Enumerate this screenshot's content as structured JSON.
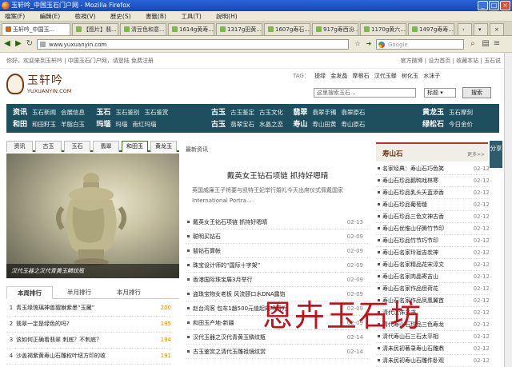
{
  "window": {
    "title": "玉轩吟_中国玉石门户网 - Mozilla Firefox"
  },
  "menu": [
    "檔案(F)",
    "編輯(E)",
    "檢視(V)",
    "歷史(S)",
    "書籤(B)",
    "工具(T)",
    "說明(H)"
  ],
  "tabs": [
    {
      "label": "玉轩吟_中国玉..."
    },
    {
      "label": "【图片】翡..."
    },
    {
      "label": "清豆色和意..."
    },
    {
      "label": "1614g黄寿..."
    },
    {
      "label": "1317g田黄..."
    },
    {
      "label": "1607g寿石..."
    },
    {
      "label": "917g寿西汾..."
    },
    {
      "label": "1170g黄六..."
    },
    {
      "label": "1497g寿寿..."
    }
  ],
  "nav": {
    "url": "www.yuxuanyin.com",
    "search_placeholder": "Google"
  },
  "topinfo": {
    "left": "你好，欢迎来到玉轩吟 | 中国玉石门户网，请登陆 免费注册",
    "right": "官方微博 | 设为首页 | 收藏本站 | 玉石说"
  },
  "logo": {
    "name": "玉轩吟",
    "domain": "YUXUANYIN.COM"
  },
  "tags": {
    "label": "TAG：",
    "items": [
      "提绿",
      "金发晶",
      "摩根石",
      "汉代玉蝉",
      "树化玉",
      "水沫子"
    ]
  },
  "sitesearch": {
    "placeholder": "这里搜索玉石...",
    "select": "标题",
    "button": "搜索"
  },
  "mainnav": [
    {
      "head": "资讯",
      "items": [
        "玉石新闻",
        "会展信息"
      ],
      "head2": "玉石",
      "items2": [
        "玉石鉴别",
        "玉石鉴赏"
      ]
    },
    {
      "head": "和田",
      "items": [
        "和田籽玉",
        "羊脂白玉"
      ],
      "head2": "玛瑙",
      "items2": [
        "玛瑙",
        "南红玛瑙"
      ]
    },
    {
      "head": "古玉",
      "items": [
        "古玉鉴定",
        "古玉文化"
      ],
      "head2": "翡翠",
      "items2": [
        "翡翠手镯",
        "翡翠原石"
      ]
    },
    {
      "head": "古玉",
      "items": [
        "翡翠宝石",
        "水晶之恋"
      ],
      "head2": "寿山",
      "items2": [
        "寿山田黄",
        "寿山原石"
      ]
    },
    {
      "head": "黄龙玉",
      "items": [
        "玉石摩刻"
      ],
      "head2": "绿松石",
      "items2": [
        "今日金价"
      ]
    }
  ],
  "cattabs": [
    "资讯",
    "古玉",
    "玉石",
    "翡翠",
    "和田玉",
    "黄龙玉"
  ],
  "photo": {
    "caption": "汉代玉器之汉代青黄玉鳞纹瓶"
  },
  "ranktabs": [
    "本周排行",
    "半月排行",
    "本月排行"
  ],
  "ranking": [
    {
      "n": "1",
      "title": "青玉缘琉璃神兽貔貅紫墨“玉藏”",
      "count": "200"
    },
    {
      "n": "2",
      "title": "翡翠一定是绿色的吗?",
      "count": "195"
    },
    {
      "n": "3",
      "title": "该如何正确看翡翠 刺底？不刺底？",
      "count": "194"
    },
    {
      "n": "4",
      "title": "沙盖褐紫黄寿山石雕权叶纽方印的收",
      "count": "191"
    }
  ],
  "middle": {
    "section": "最新资讯",
    "headline": "戴英女王钻石项链 抓持好嗯晴",
    "summary": "英国威廉王子将要与凯特王妃举行婚礼今天出席仪式佩戴国家 International Portra...",
    "news": [
      {
        "title": "戴英女王钻石项链 抓持好嗯晴",
        "date": "02-13"
      },
      {
        "title": "聪明买钻石",
        "date": "02-09"
      },
      {
        "title": "替钻石算帐",
        "date": "02-09"
      },
      {
        "title": "珠宝设计师的“国际十字架”",
        "date": "02-09"
      },
      {
        "title": "香港国际珠宝展3月举行",
        "date": "02-09"
      },
      {
        "title": "盗珠宝物女老板 风流颐口水DNA露馅",
        "date": "02-09"
      },
      {
        "title": "赵台湾客 包车1趟500元值起的吗石为",
        "date": "02-09"
      },
      {
        "title": "和田玉产地-新疆",
        "date": "02-09"
      },
      {
        "title": "汉代玉器之汉代青黄玉鳞纹瓶",
        "date": "02-14"
      },
      {
        "title": "古玉鉴赏之清代玉雕祖镜纹赏",
        "date": "02-14"
      }
    ]
  },
  "right": {
    "title": "寿山石",
    "more": "更多>>",
    "items": [
      {
        "title": "名家经典：寿山石巧色笑",
        "date": "02-12"
      },
      {
        "title": "寿山石珍品鹅鸭戏林寒",
        "date": "02-12"
      },
      {
        "title": "寿山石珍品乳头天蓝添香",
        "date": "02-12"
      },
      {
        "title": "寿山石珍品葡萄缝",
        "date": "02-12"
      },
      {
        "title": "寿山石珍品三色文神古香",
        "date": "02-12"
      },
      {
        "title": "寿山石优惟山仔腾竹节印",
        "date": "02-12"
      },
      {
        "title": "寿山石珍品竹节巧节印",
        "date": "02-12"
      },
      {
        "title": "寿山石名家玲珑吉炭神",
        "date": "02-12"
      },
      {
        "title": "寿山石名家精品花宋淳文",
        "date": "02-12"
      },
      {
        "title": "寿山石名家肉晶寄吉山",
        "date": "02-12"
      },
      {
        "title": "寿山石名家作品但荷花",
        "date": "02-12"
      },
      {
        "title": "寿山石名家作品凤凰翼首",
        "date": "02-12"
      },
      {
        "title": "清代汉饰五书",
        "date": "02-12"
      },
      {
        "title": "清代寿山石珍品三色寿龙",
        "date": "02-12"
      },
      {
        "title": "清代寿山石三石太平相",
        "date": "02-12"
      },
      {
        "title": "清未民初著录寿山石雕鼎",
        "date": "02-12"
      },
      {
        "title": "清未民初寿山石雕件卧观",
        "date": "02-12"
      },
      {
        "title": "清未民初寿山石仿古",
        "date": "02-12"
      }
    ]
  },
  "share": "分享",
  "watermark": "恩卉玉石坊"
}
